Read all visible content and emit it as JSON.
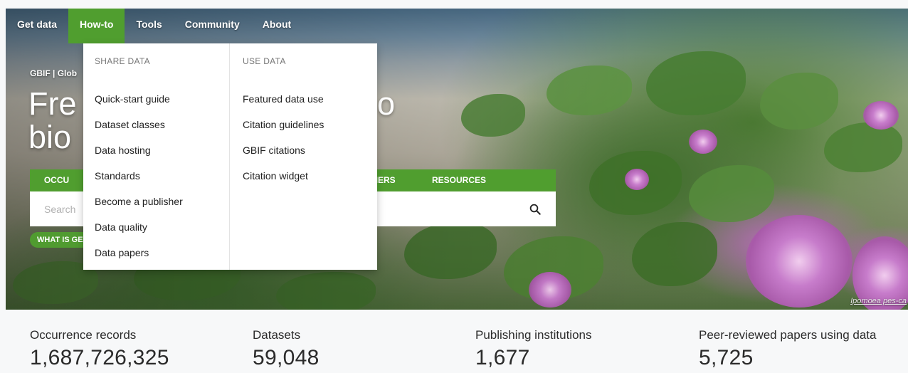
{
  "nav": {
    "items": [
      {
        "label": "Get data",
        "active": false
      },
      {
        "label": "How-to",
        "active": true
      },
      {
        "label": "Tools",
        "active": false
      },
      {
        "label": "Community",
        "active": false
      },
      {
        "label": "About",
        "active": false
      }
    ]
  },
  "hero": {
    "site_tag": "GBIF | Glob",
    "title_line1": "Fre",
    "title_line1_end": "o",
    "title_line2": "bio",
    "photo_caption": "Ipomoea pes-ca",
    "what_is_label": "WHAT IS GE"
  },
  "search": {
    "tabs": [
      "OCCU",
      "BLISHERS",
      "RESOURCES"
    ],
    "placeholder": "Search"
  },
  "dropdown": {
    "share": {
      "heading": "SHARE DATA",
      "links": [
        "Quick-start guide",
        "Dataset classes",
        "Data hosting",
        "Standards",
        "Become a publisher",
        "Data quality",
        "Data papers"
      ]
    },
    "use": {
      "heading": "USE DATA",
      "links": [
        "Featured data use",
        "Citation guidelines",
        "GBIF citations",
        "Citation widget"
      ]
    }
  },
  "stats": [
    {
      "label": "Occurrence records",
      "value": "1,687,726,325"
    },
    {
      "label": "Datasets",
      "value": "59,048"
    },
    {
      "label": "Publishing institutions",
      "value": "1,677"
    },
    {
      "label": "Peer-reviewed papers using data",
      "value": "5,725"
    }
  ],
  "colors": {
    "accent": "#509e2f"
  }
}
